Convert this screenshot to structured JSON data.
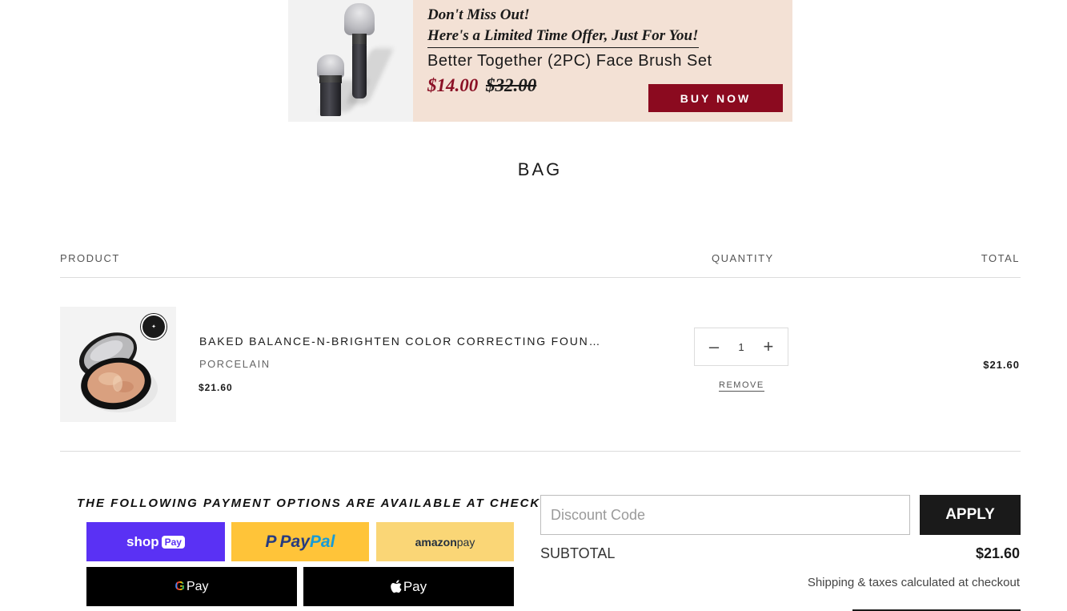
{
  "promo": {
    "line1": "Don't Miss Out!",
    "line2": "Here's a Limited Time Offer, Just For You!",
    "product": "Better Together (2PC) Face Brush Set",
    "sale_price": "$14.00",
    "original_price": "$32.00",
    "buy_label": "BUY NOW"
  },
  "page": {
    "title": "BAG"
  },
  "columns": {
    "product": "PRODUCT",
    "quantity": "QUANTITY",
    "total": "TOTAL"
  },
  "cart_item": {
    "name": "BAKED BALANCE-N-BRIGHTEN COLOR CORRECTING FOUN…",
    "variant": "PORCELAIN",
    "price": "$21.60",
    "quantity": "1",
    "remove_label": "REMOVE",
    "line_total": "$21.60"
  },
  "payment": {
    "heading": "THE FOLLOWING PAYMENT OPTIONS ARE AVAILABLE AT CHECKOUT:",
    "shop_pay": {
      "word": "shop",
      "pill": "Pay"
    },
    "paypal": {
      "a": "Pay",
      "b": "Pal",
      "mark": "P"
    },
    "amazon_pay": {
      "a": "amazon",
      "b": " pay"
    },
    "google_pay": {
      "g": "G",
      "text": "Pay"
    },
    "apple_pay": {
      "logo": "",
      "text": "Pay"
    }
  },
  "summary": {
    "discount_placeholder": "Discount Code",
    "apply_label": "APPLY",
    "subtotal_label": "SUBTOTAL",
    "subtotal_value": "$21.60",
    "shipping_note": "Shipping & taxes calculated at checkout"
  },
  "colors": {
    "promo_bg": "#f3e1d5",
    "buy_button": "#8b0a1f",
    "sale_price": "#8b1126",
    "shop_pay": "#5a31f4",
    "paypal": "#ffc439",
    "amazon_pay": "#fad676"
  }
}
